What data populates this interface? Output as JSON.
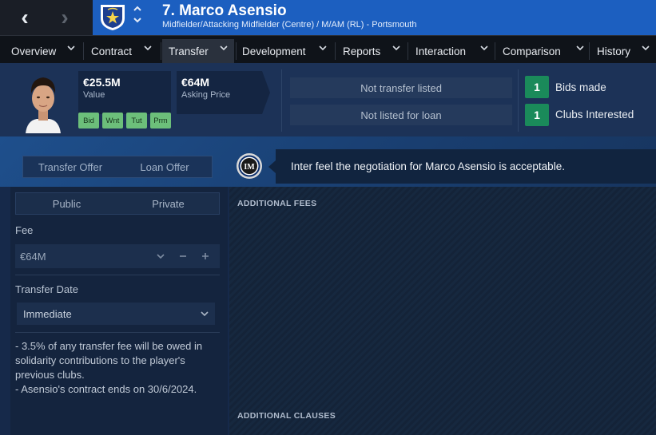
{
  "header": {
    "back_glyph": "‹",
    "forward_glyph": "›",
    "player_name": "7. Marco Asensio",
    "player_subtitle": "Midfielder/Attacking Midfielder (Centre) / M/AM (RL) - Portsmouth",
    "crest_icon": "portsmouth-crest-icon",
    "title_bg_color": "#1c5fc0"
  },
  "tabs": [
    {
      "label": "Overview"
    },
    {
      "label": "Contract"
    },
    {
      "label": "Transfer",
      "active": true
    },
    {
      "label": "Development"
    },
    {
      "label": "Reports"
    },
    {
      "label": "Interaction"
    },
    {
      "label": "Comparison"
    },
    {
      "label": "History"
    }
  ],
  "summary": {
    "value": {
      "amount": "€25.5M",
      "label": "Value"
    },
    "asking": {
      "amount": "€64M",
      "label": "Asking Price"
    },
    "badges": [
      "Bid",
      "Wnt",
      "Tut",
      "Prm"
    ],
    "transfer_status": "Not transfer listed",
    "loan_status": "Not listed for loan",
    "bids": {
      "count": "1",
      "label": "Bids made"
    },
    "clubs": {
      "count": "1",
      "label": "Clubs Interested"
    },
    "count_color": "#1a8a5a"
  },
  "negotiation": {
    "offer_types": [
      "Transfer Offer",
      "Loan Offer"
    ],
    "club_icon": "inter-crest-icon",
    "feedback": "Inter feel the negotiation for Marco Asensio is acceptable."
  },
  "offer": {
    "visibility": [
      "Public",
      "Private"
    ],
    "fee_label": "Fee",
    "fee_value": "€64M",
    "date_label": "Transfer Date",
    "date_value": "Immediate",
    "notes": [
      "- 3.5% of any transfer fee will be owed in solidarity contributions to the player's previous clubs.",
      "- Asensio's contract ends on 30/6/2024."
    ]
  },
  "sections": {
    "additional_fees": "ADDITIONAL FEES",
    "additional_clauses": "ADDITIONAL CLAUSES"
  }
}
